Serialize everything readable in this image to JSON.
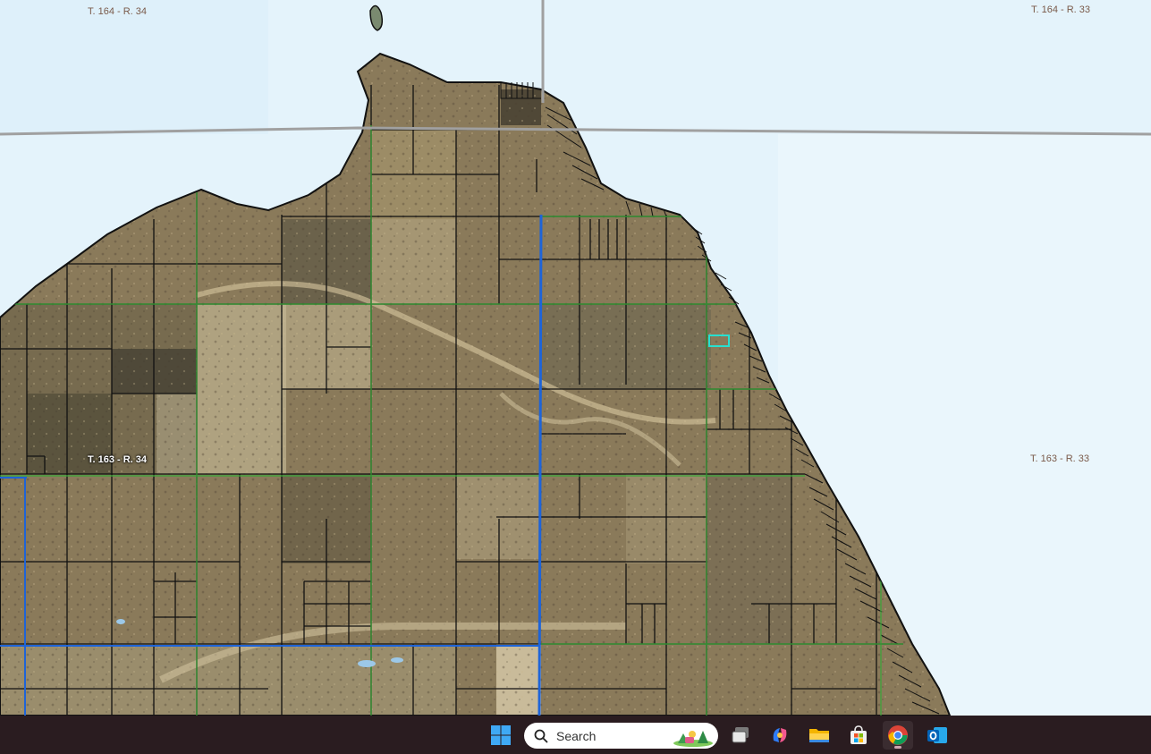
{
  "map": {
    "township_labels": [
      {
        "id": "nw",
        "text": "T. 164 - R. 34"
      },
      {
        "id": "ne",
        "text": "T. 164 - R. 33"
      },
      {
        "id": "sw",
        "text": "T. 163 - R. 34"
      },
      {
        "id": "se",
        "text": "T. 163 - R. 33"
      }
    ],
    "colors": {
      "water": "#e4f3fb",
      "land": "#8a7a5a",
      "parcel_line": "#111111",
      "section_line": "#3aa63a",
      "township_line": "#1e64d8",
      "state_line": "#a0a0a0",
      "selected_parcel": "#27e0d0"
    }
  },
  "taskbar": {
    "search_placeholder": "Search",
    "icons": [
      "windows-start-icon",
      "task-view-icon",
      "copilot-icon",
      "file-explorer-icon",
      "microsoft-store-icon",
      "chrome-icon",
      "outlook-icon"
    ],
    "active_app": "chrome-icon"
  }
}
